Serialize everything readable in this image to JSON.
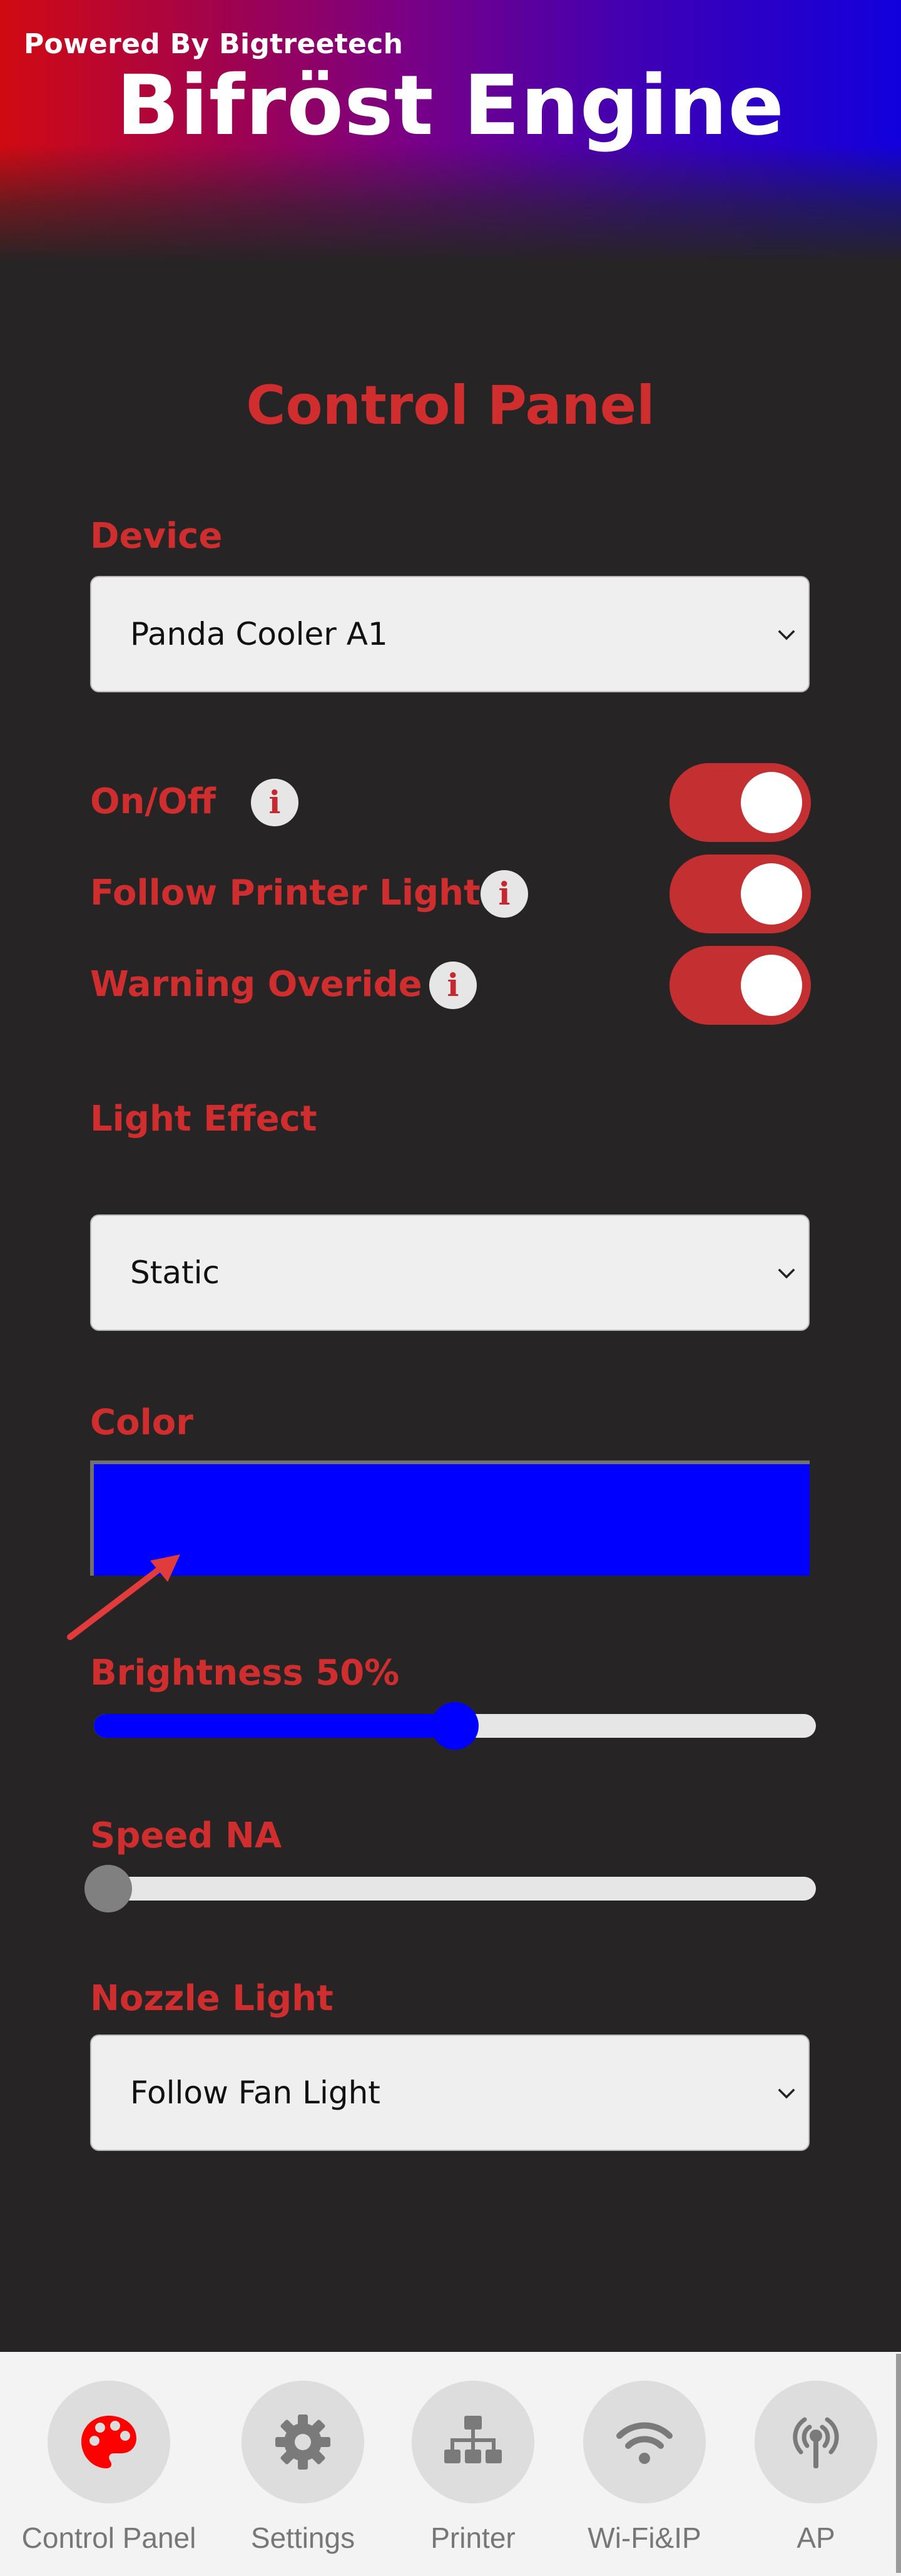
{
  "header": {
    "powered_by": "Powered By Bigtreetech",
    "title": "Bifröst Engine"
  },
  "page_title": "Control Panel",
  "device": {
    "label": "Device",
    "selected": "Panda Cooler A1"
  },
  "toggles": [
    {
      "label": "On/Off",
      "info": "i",
      "on": true
    },
    {
      "label": "Follow Printer Light",
      "info": "i",
      "on": true
    },
    {
      "label": "Warning Overide",
      "info": "i",
      "on": true
    }
  ],
  "light_effect": {
    "label": "Light Effect",
    "selected": "Static"
  },
  "color": {
    "label": "Color",
    "value": "#0000ff"
  },
  "brightness": {
    "label": "Brightness 50%",
    "value": 0.5,
    "fill_color": "#0000ff",
    "thumb_color": "#0000ff"
  },
  "speed": {
    "label": "Speed NA",
    "value": 0,
    "thumb_color": "#808080"
  },
  "nozzle_light": {
    "label": "Nozzle Light",
    "selected": "Follow Fan Light"
  },
  "bottom_nav": [
    {
      "label": "Control Panel",
      "icon": "palette-icon",
      "active": true
    },
    {
      "label": "Settings",
      "icon": "gear-icon",
      "active": false
    },
    {
      "label": "Printer",
      "icon": "network-tree-icon",
      "active": false
    },
    {
      "label": "Wi-Fi&IP",
      "icon": "wifi-icon",
      "active": false
    },
    {
      "label": "AP",
      "icon": "antenna-icon",
      "active": false
    }
  ],
  "colors": {
    "accent": "#d02e2e",
    "toggle_on": "#c42f31",
    "background": "#262425"
  }
}
